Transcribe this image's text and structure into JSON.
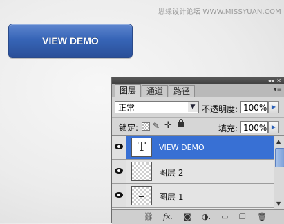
{
  "watermark": "思缘设计论坛 WWW.MISSYUAN.COM",
  "demo_button": {
    "label": "VIEW DEMO"
  },
  "panel": {
    "tabs": [
      {
        "label": "图层",
        "active": true
      },
      {
        "label": "通道",
        "active": false
      },
      {
        "label": "路径",
        "active": false
      }
    ],
    "blend_mode": "正常",
    "opacity_label": "不透明度:",
    "opacity_value": "100%",
    "lock_label": "锁定:",
    "fill_label": "填充:",
    "fill_value": "100%",
    "layers": [
      {
        "name": "VIEW DEMO",
        "thumb": "T",
        "selected": true,
        "visible": true
      },
      {
        "name": "图层 2",
        "selected": false,
        "visible": true
      },
      {
        "name": "图层 1",
        "selected": false,
        "visible": true
      }
    ],
    "accent_color": "#3870d4"
  }
}
